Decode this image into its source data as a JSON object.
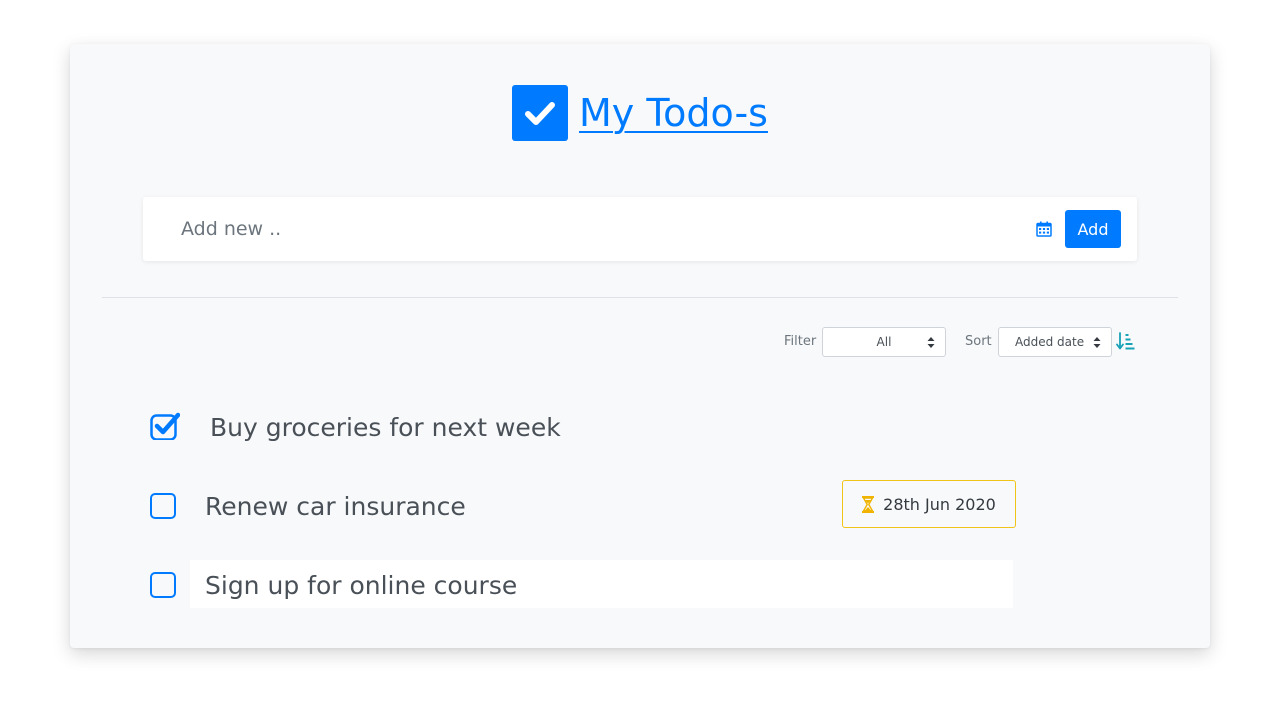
{
  "header": {
    "logo_icon": "checkbox-checked-icon",
    "title": "My Todo-s"
  },
  "add_bar": {
    "placeholder": "Add new ..",
    "calendar_icon": "calendar-icon",
    "add_label": "Add"
  },
  "controls": {
    "filter_label": "Filter",
    "filter_value": "All",
    "sort_label": "Sort",
    "sort_value": "Added date",
    "sort_direction_icon": "sort-numeric-down-icon"
  },
  "todos": [
    {
      "text": "Buy groceries for next week",
      "done": true
    },
    {
      "text": "Renew car insurance",
      "done": false,
      "due": "28th Jun 2020"
    },
    {
      "text": "Sign up for online course",
      "done": false
    }
  ],
  "colors": {
    "accent": "#007bff",
    "due_border": "#f0c419",
    "hourglass": "#f0b400",
    "sort_icon": "#17a2b8"
  }
}
